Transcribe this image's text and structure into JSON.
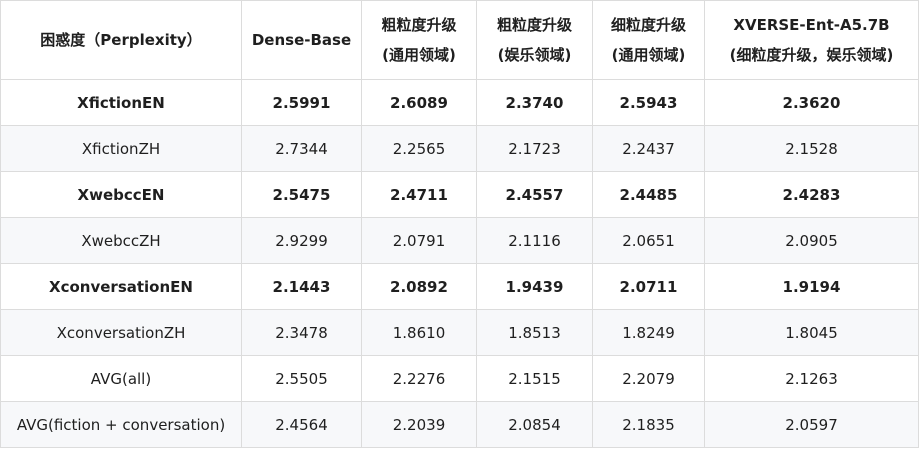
{
  "table": {
    "columns": [
      {
        "line1": "困惑度（Perplexity）",
        "line2": ""
      },
      {
        "line1": "Dense-Base",
        "line2": ""
      },
      {
        "line1": "粗粒度升级",
        "line2": "(通用领域)"
      },
      {
        "line1": "粗粒度升级",
        "line2": "(娱乐领域)"
      },
      {
        "line1": "细粒度升级",
        "line2": "(通用领域)"
      },
      {
        "line1": "XVERSE-Ent-A5.7B",
        "line2": "(细粒度升级，娱乐领域)"
      }
    ],
    "rows": [
      {
        "bold": true,
        "cells": [
          "XfictionEN",
          "2.5991",
          "2.6089",
          "2.3740",
          "2.5943",
          "2.3620"
        ]
      },
      {
        "bold": false,
        "cells": [
          "XfictionZH",
          "2.7344",
          "2.2565",
          "2.1723",
          "2.2437",
          "2.1528"
        ]
      },
      {
        "bold": true,
        "cells": [
          "XwebccEN",
          "2.5475",
          "2.4711",
          "2.4557",
          "2.4485",
          "2.4283"
        ]
      },
      {
        "bold": false,
        "cells": [
          "XwebccZH",
          "2.9299",
          "2.0791",
          "2.1116",
          "2.0651",
          "2.0905"
        ]
      },
      {
        "bold": true,
        "cells": [
          "XconversationEN",
          "2.1443",
          "2.0892",
          "1.9439",
          "2.0711",
          "1.9194"
        ]
      },
      {
        "bold": false,
        "cells": [
          "XconversationZH",
          "2.3478",
          "1.8610",
          "1.8513",
          "1.8249",
          "1.8045"
        ]
      },
      {
        "bold": false,
        "cells": [
          "AVG(all)",
          "2.5505",
          "2.2276",
          "2.1515",
          "2.2079",
          "2.1263"
        ]
      },
      {
        "bold": false,
        "cells": [
          "AVG(fiction + conversation)",
          "2.4564",
          "2.2039",
          "2.0854",
          "2.1835",
          "2.0597"
        ]
      }
    ]
  }
}
